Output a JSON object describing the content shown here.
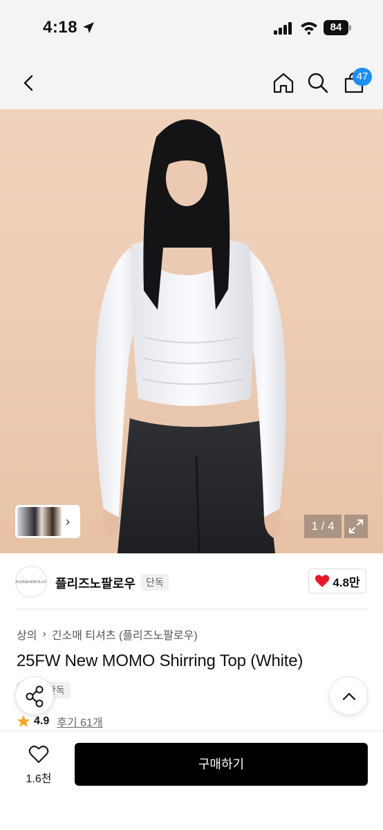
{
  "status_bar": {
    "time": "4:18",
    "battery": "84"
  },
  "nav": {
    "cart_count": "47"
  },
  "gallery": {
    "counter": "1 / 4"
  },
  "brand": {
    "logo_text": "PLEASENOFOLLOW",
    "name": "플리즈노팔로우",
    "badge": "단독",
    "like_count": "4.8만"
  },
  "product": {
    "breadcrumb": [
      "상의",
      "긴소매 티셔츠 (플리즈노팔로우)"
    ],
    "title": "25FW New MOMO Shirring Top (White)",
    "tag": "단독",
    "rating": "4.9",
    "review_link": "후기 61개"
  },
  "bottom": {
    "wish_count": "1.6천",
    "buy_label": "구매하기"
  },
  "colors": {
    "heart": "#e8172a",
    "star": "#f5a623",
    "cart_badge": "#1f8ef1",
    "buy_button": "#000000"
  }
}
